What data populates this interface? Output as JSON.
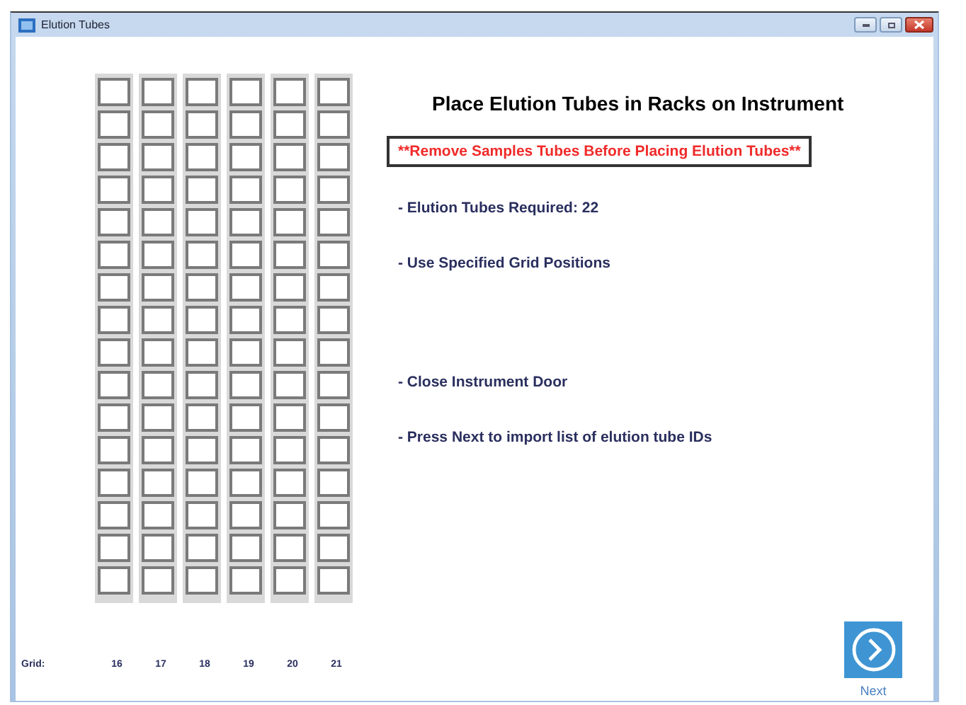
{
  "window": {
    "title": "Elution Tubes"
  },
  "rack": {
    "grid_label": "Grid:",
    "columns": [
      {
        "grid": "16",
        "tubes": [
          {
            "filled": false
          },
          {
            "filled": false
          },
          {
            "filled": false
          },
          {
            "filled": false
          },
          {
            "filled": false
          },
          {
            "filled": false
          },
          {
            "filled": false
          },
          {
            "filled": false
          },
          {
            "filled": false
          },
          {
            "filled": false
          },
          {
            "filled": false
          },
          {
            "filled": false
          },
          {
            "filled": false
          },
          {
            "filled": false
          },
          {
            "filled": false
          },
          {
            "filled": false
          }
        ]
      },
      {
        "grid": "17",
        "tubes": [
          {
            "filled": false
          },
          {
            "filled": false
          },
          {
            "filled": false
          },
          {
            "filled": false
          },
          {
            "filled": false
          },
          {
            "filled": false
          },
          {
            "filled": false
          },
          {
            "filled": false
          },
          {
            "filled": false
          },
          {
            "filled": false
          },
          {
            "filled": false
          },
          {
            "filled": false
          },
          {
            "filled": false
          },
          {
            "filled": false
          },
          {
            "filled": false
          },
          {
            "filled": false
          }
        ]
      },
      {
        "grid": "18",
        "tubes": [
          {
            "filled": false
          },
          {
            "filled": false
          },
          {
            "filled": false
          },
          {
            "filled": false
          },
          {
            "filled": false
          },
          {
            "filled": false
          },
          {
            "filled": false
          },
          {
            "filled": false
          },
          {
            "filled": false
          },
          {
            "filled": false
          },
          {
            "filled": false
          },
          {
            "filled": false
          },
          {
            "filled": false
          },
          {
            "filled": false
          },
          {
            "filled": false
          },
          {
            "filled": false
          }
        ]
      },
      {
        "grid": "19",
        "tubes": [
          {
            "filled": false
          },
          {
            "filled": false
          },
          {
            "filled": false
          },
          {
            "filled": false
          },
          {
            "filled": false
          },
          {
            "filled": false
          },
          {
            "filled": false
          },
          {
            "filled": false
          },
          {
            "filled": false
          },
          {
            "filled": false
          },
          {
            "filled": false
          },
          {
            "filled": false
          },
          {
            "filled": false
          },
          {
            "filled": false
          },
          {
            "filled": false
          },
          {
            "filled": false
          }
        ]
      },
      {
        "grid": "20",
        "tubes": [
          {
            "filled": false
          },
          {
            "filled": false
          },
          {
            "filled": false
          },
          {
            "filled": false
          },
          {
            "filled": false
          },
          {
            "filled": false
          },
          {
            "filled": false
          },
          {
            "filled": false
          },
          {
            "filled": false
          },
          {
            "filled": false
          },
          {
            "filled": false
          },
          {
            "filled": false
          },
          {
            "filled": false
          },
          {
            "filled": false
          },
          {
            "filled": false
          },
          {
            "filled": false
          }
        ]
      },
      {
        "grid": "21",
        "tubes": [
          {
            "filled": false
          },
          {
            "filled": false
          },
          {
            "filled": false
          },
          {
            "filled": false
          },
          {
            "filled": false
          },
          {
            "filled": false
          },
          {
            "filled": false
          },
          {
            "filled": false
          },
          {
            "filled": false
          },
          {
            "filled": false
          },
          {
            "filled": false
          },
          {
            "filled": false
          },
          {
            "filled": false
          },
          {
            "filled": false
          },
          {
            "filled": false
          },
          {
            "filled": false
          }
        ]
      }
    ]
  },
  "heading": "Place Elution Tubes in Racks on Instrument",
  "warning": "**Remove Samples Tubes Before Placing Elution Tubes**",
  "steps": [
    {
      "text": "- Elution Tubes Required: 22"
    },
    {
      "text": "- Use Specified Grid Positions"
    },
    {
      "text": "- Close Instrument Door"
    },
    {
      "text": "- Press Next to import list of elution tube IDs"
    }
  ],
  "next_button": {
    "label": "Next"
  }
}
